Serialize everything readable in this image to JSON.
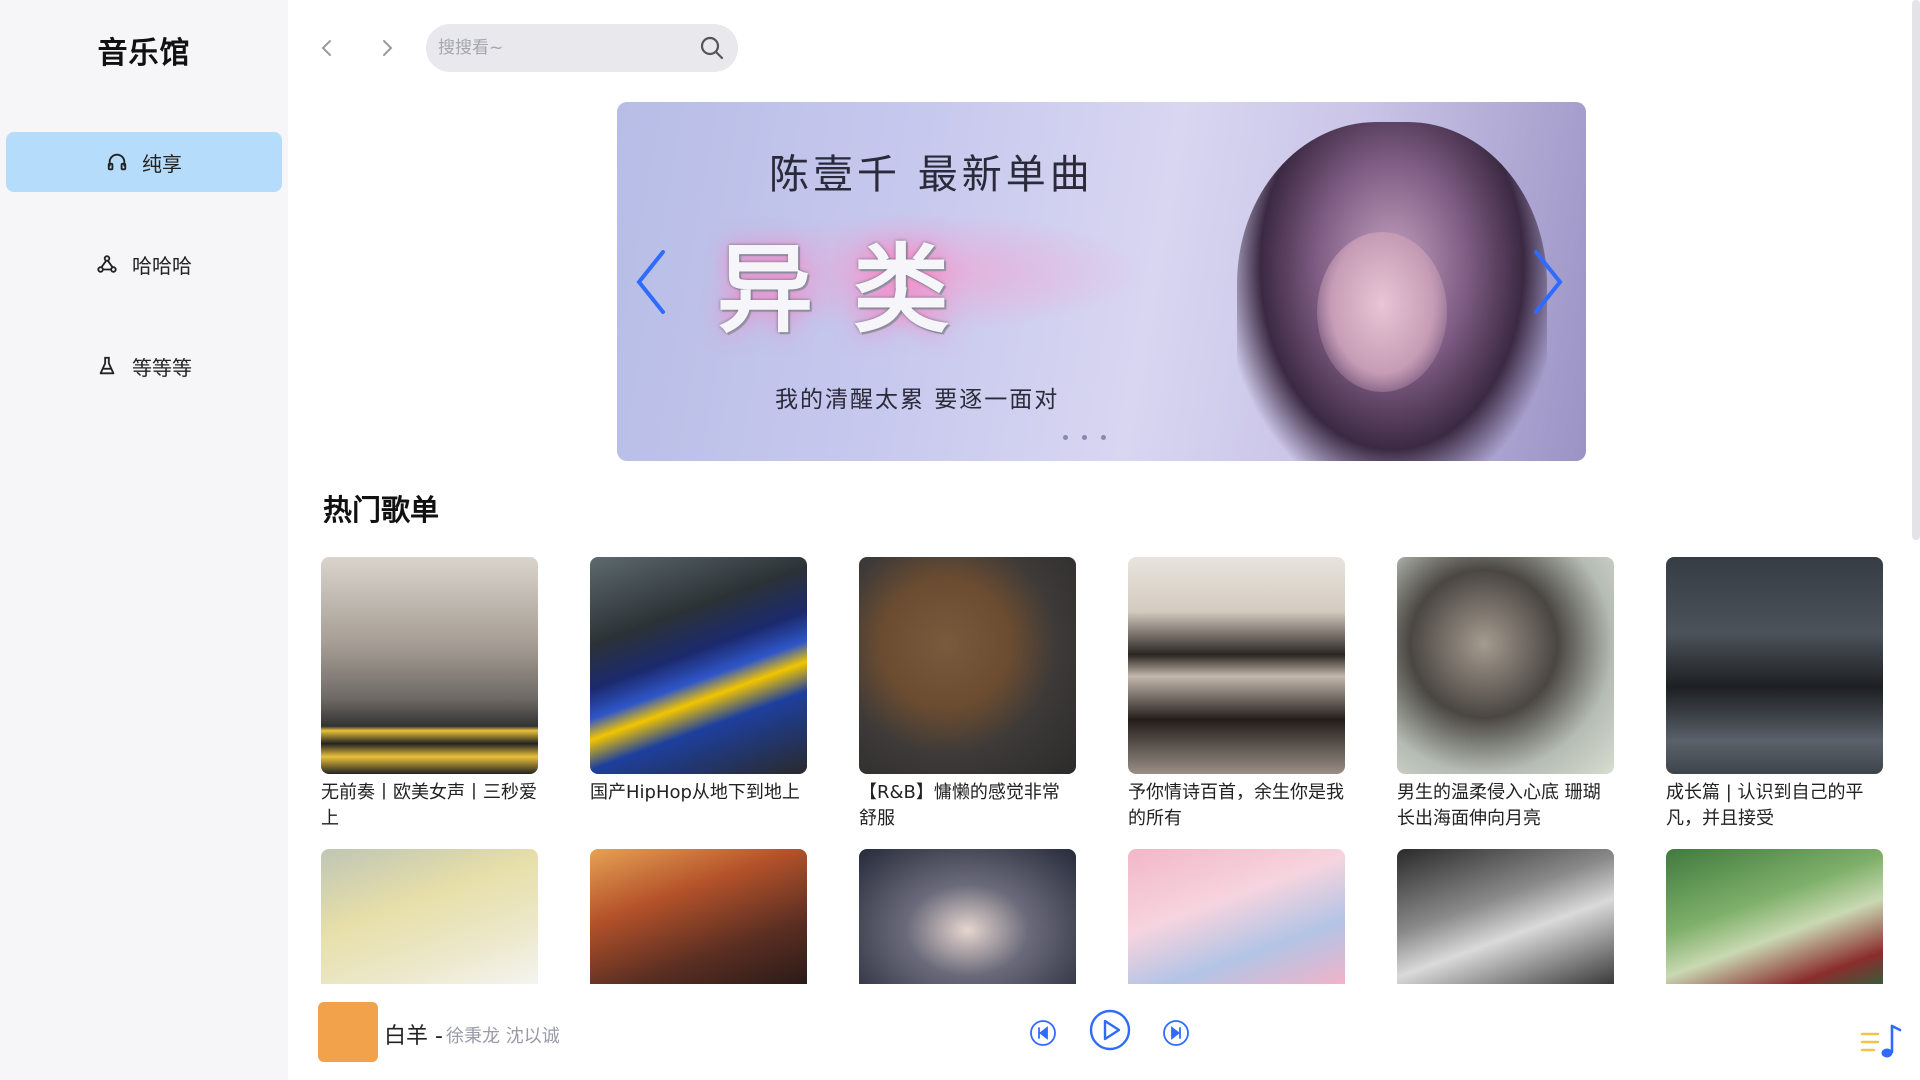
{
  "app": {
    "title": "音乐馆"
  },
  "sidebar": {
    "items": [
      {
        "label": "纯享",
        "icon": "headphones-icon",
        "active": true
      },
      {
        "label": "哈哈哈",
        "icon": "network-icon",
        "active": false
      },
      {
        "label": "等等等",
        "icon": "flask-icon",
        "active": false
      }
    ]
  },
  "search": {
    "placeholder": "搜搜看~",
    "value": ""
  },
  "banner": {
    "title": "陈壹千 最新单曲",
    "big_text": "异类",
    "subtitle": "我的清醒太累 要逐一面对",
    "slide_count": 3
  },
  "playlists": {
    "section_title": "热门歌单",
    "items": [
      {
        "title": "无前奏丨欧美女声丨三秒爱上"
      },
      {
        "title": "国产HipHop从地下到地上"
      },
      {
        "title": "【R&B】慵懒的感觉非常舒服"
      },
      {
        "title": "予你情诗百首，余生你是我的所有"
      },
      {
        "title": "男生的温柔侵入心底 珊瑚长出海面伸向月亮"
      },
      {
        "title": "成长篇 | 认识到自己的平凡，并且接受"
      }
    ]
  },
  "player": {
    "song": "白羊 -",
    "artist": "徐秉龙 沈以诚",
    "accent": "#2f6bff"
  },
  "colors": {
    "accent": "#2f6bff",
    "nav_active": "#b6dcfb",
    "sidebar_bg": "#f6f6f9",
    "playlist_icon": "#f2c14a"
  }
}
